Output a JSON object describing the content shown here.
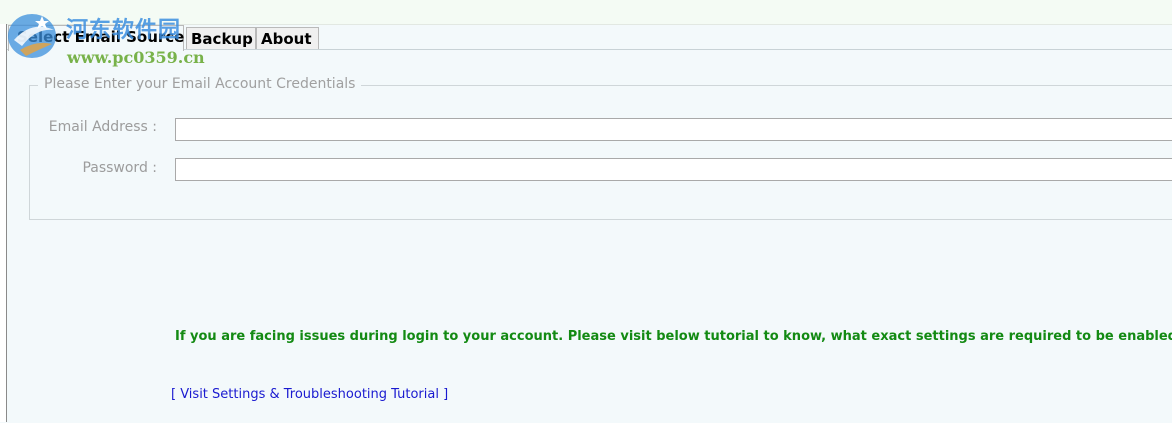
{
  "tabs": [
    {
      "label": "Select Email Source",
      "active": true
    },
    {
      "label": "Backup",
      "active": false
    },
    {
      "label": "About",
      "active": false
    }
  ],
  "credentials": {
    "legend": "Please Enter your Email Account Credentials",
    "email_label": "Email Address :",
    "email_value": "",
    "password_label": "Password :",
    "password_value": ""
  },
  "notice": "If you are facing issues during login to your account. Please visit below tutorial to know, what exact settings are required to be enabled.",
  "tutorial_link": "[ Visit Settings & Troubleshooting Tutorial ]",
  "watermark": {
    "title": "河东软件园",
    "url": "www.pc0359.cn"
  },
  "colors": {
    "notice": "#138a13",
    "link": "#1a1ad0",
    "watermark_title": "#3c8fe0",
    "watermark_url": "#78b24a"
  },
  "icons": {
    "watermark_logo": "watermark-logo-icon"
  }
}
